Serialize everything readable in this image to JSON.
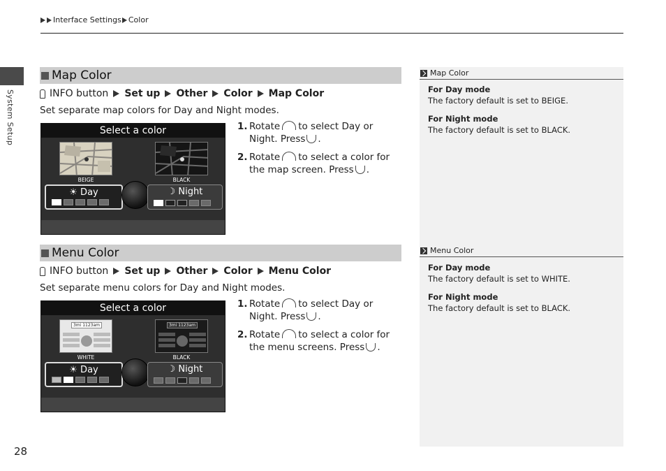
{
  "breadcrumb": {
    "part1": "Interface Settings",
    "part2": "Color"
  },
  "side": {
    "label": "System Setup"
  },
  "page_number": "28",
  "sections": {
    "map": {
      "title": "Map Color",
      "path": {
        "start": "INFO button",
        "step1": "Set up",
        "step2": "Other",
        "step3": "Color",
        "step4": "Map Color"
      },
      "intro": "Set separate map colors for Day and Night modes.",
      "screen": {
        "title": "Select a color",
        "left_caption": "BEIGE",
        "right_caption": "BLACK",
        "tab_day": "☀ Day",
        "tab_night": "☽ Night"
      },
      "steps": {
        "s1_num": "1.",
        "s1_a": "Rotate",
        "s1_b": "to select",
        "s1_day": "Day",
        "s1_or": "or",
        "s1_night": "Night",
        "s1_dot": ".",
        "s1_press": "Press",
        "s1_end": ".",
        "s2_num": "2.",
        "s2_a": "Rotate",
        "s2_b": "to select a color for the map screen. Press",
        "s2_end": "."
      }
    },
    "menu": {
      "title": "Menu Color",
      "path": {
        "start": "INFO button",
        "step1": "Set up",
        "step2": "Other",
        "step3": "Color",
        "step4": "Menu Color"
      },
      "intro": "Set separate menu colors for Day and Night modes.",
      "screen": {
        "title": "Select a color",
        "left_caption": "WHITE",
        "right_caption": "BLACK",
        "tab_day": "☀ Day",
        "tab_night": "☽ Night",
        "left_thumb": "3mi 1123am",
        "right_thumb": "3mi 1123am"
      },
      "steps": {
        "s1_num": "1.",
        "s1_a": "Rotate",
        "s1_b": "to select",
        "s1_day": "Day",
        "s1_or": "or",
        "s1_night": "Night",
        "s1_dot": ".",
        "s1_press": "Press",
        "s1_end": ".",
        "s2_num": "2.",
        "s2_a": "Rotate",
        "s2_b": "to select a color for the menu screens. Press",
        "s2_end": "."
      }
    }
  },
  "notes": {
    "map": {
      "heading": "Map Color",
      "day_head": "For Day mode",
      "day_text": "The factory default is set to",
      "day_value": "BEIGE",
      "day_end": ".",
      "night_head": "For Night mode",
      "night_text": "The factory default is set to",
      "night_value": "BLACK",
      "night_end": "."
    },
    "menu": {
      "heading": "Menu Color",
      "day_head": "For Day mode",
      "day_text": "The factory default is set to",
      "day_value": "WHITE",
      "day_end": ".",
      "night_head": "For Night mode",
      "night_text": "The factory default is set to",
      "night_value": "BLACK",
      "night_end": "."
    }
  },
  "colors": {
    "section_header_bg": "#cdcdcd",
    "sidebar_bg": "#f1f1f1",
    "side_tab": "#4a4a4a"
  },
  "icons": {
    "info_button": "info-button-icon",
    "rotate": "rotate-dial-icon",
    "press": "press-icon",
    "note": "note-double-arrow-icon",
    "square": "section-square-icon"
  }
}
